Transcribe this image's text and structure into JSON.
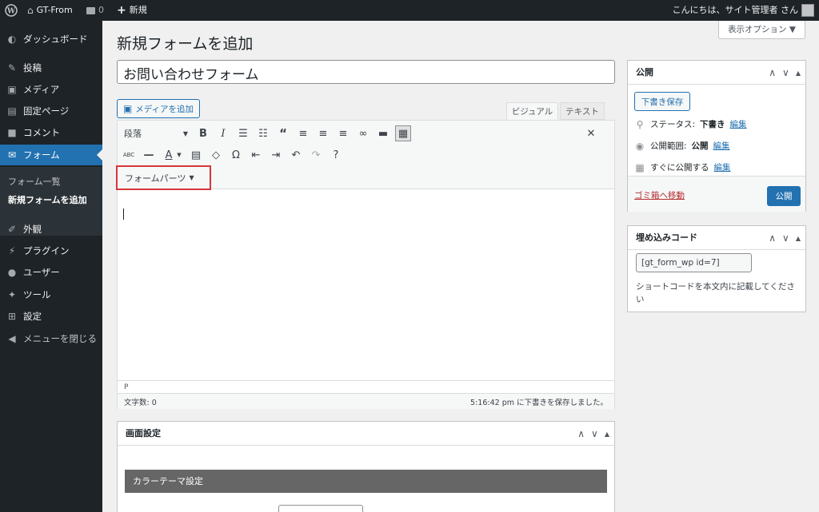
{
  "admin_bar": {
    "site_name": "GT-From",
    "comments_count": "0",
    "new_label": "新規",
    "greeting": "こんにちは、サイト管理者 さん"
  },
  "sidebar": {
    "items": [
      {
        "label": "ダッシュボード",
        "icon": "dashboard-icon"
      },
      {
        "label": "投稿",
        "icon": "pin-icon"
      },
      {
        "label": "メディア",
        "icon": "media-icon"
      },
      {
        "label": "固定ページ",
        "icon": "page-icon"
      },
      {
        "label": "コメント",
        "icon": "comment-icon"
      },
      {
        "label": "フォーム",
        "icon": "mail-icon"
      },
      {
        "label": "外観",
        "icon": "brush-icon"
      },
      {
        "label": "プラグイン",
        "icon": "plugin-icon"
      },
      {
        "label": "ユーザー",
        "icon": "user-icon"
      },
      {
        "label": "ツール",
        "icon": "wrench-icon"
      },
      {
        "label": "設定",
        "icon": "settings-icon"
      },
      {
        "label": "メニューを閉じる",
        "icon": "collapse-icon"
      }
    ],
    "submenu": [
      "フォーム一覧",
      "新規フォームを追加"
    ]
  },
  "page": {
    "title": "新規フォームを追加",
    "screen_options": "表示オプション ▼",
    "form_title_value": "お問い合わせフォーム"
  },
  "editor": {
    "add_media_label": "メディアを追加",
    "tab_visual": "ビジュアル",
    "tab_text": "テキスト",
    "format_value": "段落",
    "form_parts_label": "フォームパーツ",
    "path": "P",
    "word_count": "文字数: 0",
    "save_status": "5:16:42 pm に下書きを保存しました。"
  },
  "publish": {
    "title": "公開",
    "save_draft": "下書き保存",
    "status_label": "ステータス:",
    "status_value": "下書き",
    "visibility_label": "公開範囲:",
    "visibility_value": "公開",
    "schedule_label": "すぐに公開する",
    "edit_link": "編集",
    "trash_link": "ゴミ箱へ移動",
    "publish_button": "公開"
  },
  "embed": {
    "title": "埋め込みコード",
    "shortcode": "[gt_form_wp id=7]",
    "note": "ショートコードを本文内に記載してください"
  },
  "screen_settings": {
    "title": "画面設定",
    "color_theme_heading": "カラーテーマ設定"
  },
  "colors": {
    "admin_bar_bg": "#1d2327",
    "accent": "#2271b1",
    "highlight_border": "#d63638",
    "trash": "#b32d2e"
  }
}
